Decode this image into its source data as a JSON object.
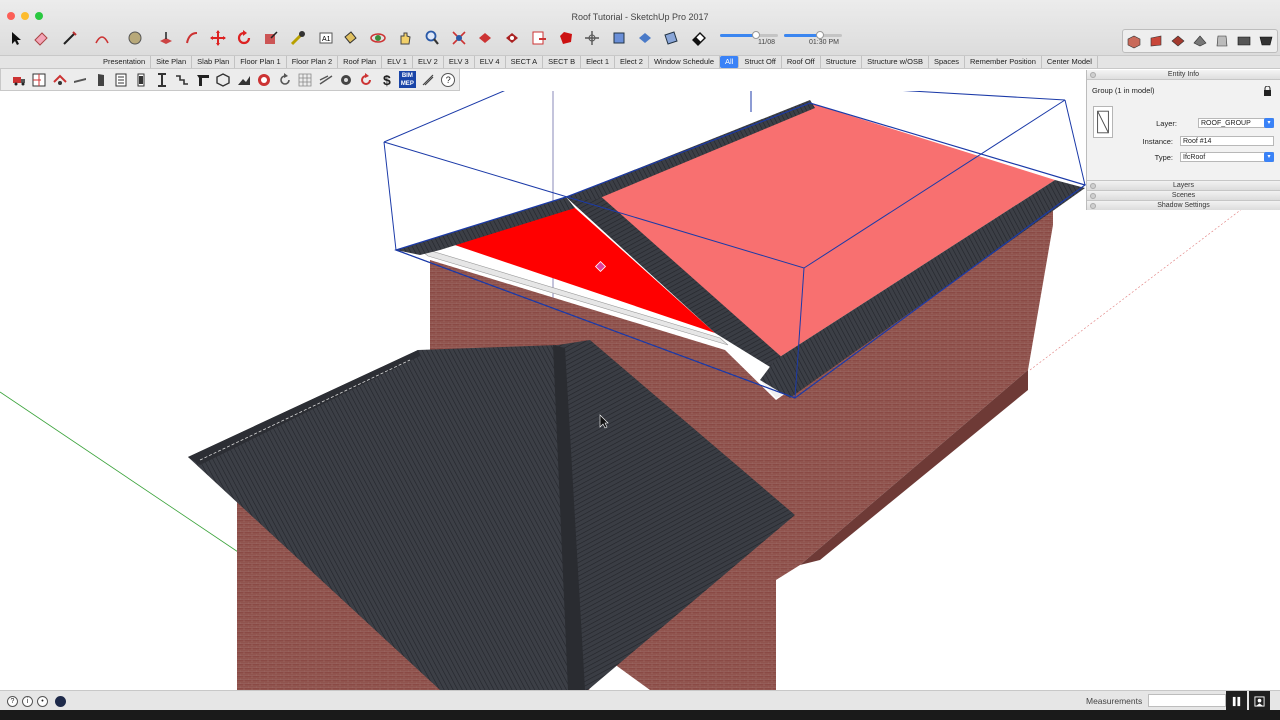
{
  "window": {
    "title": "Roof Tutorial - SketchUp Pro 2017"
  },
  "toolbar": {
    "tools": [
      "select-icon",
      "eraser-icon",
      "line-icon",
      "arc-icon",
      "shape-icon",
      "push-pull-icon",
      "follow-me-icon",
      "move-icon",
      "rotate-icon",
      "scale-icon",
      "tape-measure-icon",
      "text-icon",
      "paint-bucket-icon",
      "orbit-icon",
      "pan-icon",
      "zoom-icon",
      "zoom-extents-icon",
      "warehouse-icon",
      "extension-warehouse-icon",
      "send-to-layout-icon",
      "ruby-icon",
      "position-camera-icon",
      "walk-icon",
      "look-around-icon",
      "section-plane-icon",
      "eraser-small-icon"
    ],
    "shadow_time": {
      "date_label": "11/08",
      "time_label": "01:30 PM",
      "date_fraction": 0.62,
      "time_fraction": 0.62
    },
    "views": [
      "iso-view-icon",
      "top-view-icon",
      "front-view-icon",
      "right-view-icon",
      "back-view-icon",
      "left-view-icon",
      "bottom-view-icon"
    ]
  },
  "scenes": {
    "tabs": [
      "Presentation",
      "Site Plan",
      "Slab Plan",
      "Floor Plan 1",
      "Floor Plan 2",
      "Roof Plan",
      "ELV 1",
      "ELV 2",
      "ELV 3",
      "ELV 4",
      "SECT A",
      "SECT B",
      "Elect 1",
      "Elect 2",
      "Window Schedule",
      "All",
      "Struct Off",
      "Roof Off",
      "Structure",
      "Structure w/OSB",
      "Spaces",
      "Remember Position",
      "Center Model"
    ],
    "active": "All"
  },
  "plugin_toolbar": {
    "tools": [
      "truck-icon",
      "floor-plan-icon",
      "roof-tool-icon",
      "beam-icon",
      "door-icon",
      "wall-panel-icon",
      "column-icon",
      "i-beam-icon",
      "stair-icon",
      "corner-icon",
      "hexagon-icon",
      "terrain-icon",
      "camera-icon",
      "rotate-arrow-icon",
      "grid-icon",
      "rebar-icon",
      "gear-icon",
      "refresh-icon",
      "dollar-icon",
      "bim-mep-icon",
      "measure-icon",
      "help-icon"
    ],
    "dollar": "$",
    "bim_line1": "BIM",
    "bim_line2": "MEP",
    "help": "?"
  },
  "entity_info": {
    "title": "Entity Info",
    "selection": "Group (1 in model)",
    "layer_label": "Layer:",
    "layer_value": "ROOF_GROUP",
    "instance_label": "Instance:",
    "instance_value": "Roof #14",
    "type_label": "Type:",
    "type_value": "IfcRoof",
    "sections": [
      "Layers",
      "Scenes",
      "Shadow Settings"
    ]
  },
  "statusbar": {
    "measurements_label": "Measurements",
    "measurements_value": ""
  },
  "colors": {
    "selected_roof": "#f87070",
    "selected_face": "#ff0000",
    "roof_metal": "#3a3d44",
    "brick": "#8a4a45",
    "bounding_box": "#1b3aa8",
    "accent": "#3a82f7"
  }
}
